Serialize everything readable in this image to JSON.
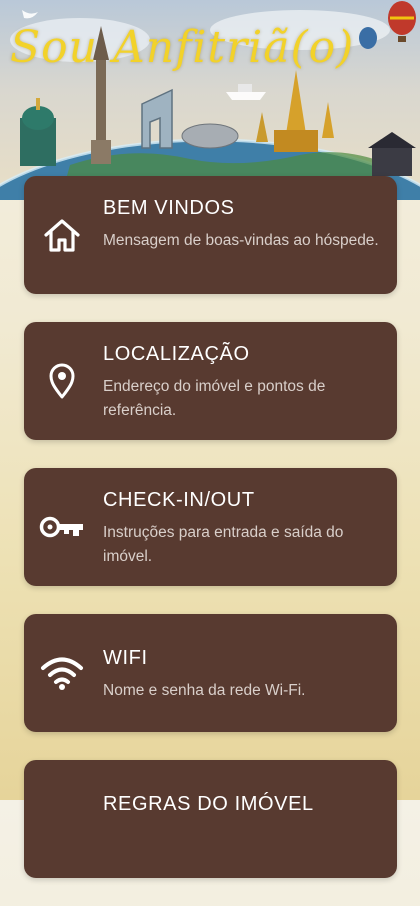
{
  "header": {
    "title": "Sou Anfitriã(o)",
    "title_color": "#f2d22a"
  },
  "menu": {
    "card_color": "#583a30",
    "items": [
      {
        "icon": "home-icon",
        "label": "BEM VINDOS",
        "description": "Mensagem de boas-vindas ao hóspede."
      },
      {
        "icon": "location-pin-icon",
        "label": "LOCALIZAÇÃO",
        "description": "Endereço do imóvel e pontos de referência."
      },
      {
        "icon": "key-icon",
        "label": "CHECK-IN/OUT",
        "description": "Instruções para entrada e saída do imóvel."
      },
      {
        "icon": "wifi-icon",
        "label": "WIFI",
        "description": "Nome e senha da rede Wi-Fi."
      },
      {
        "icon": "",
        "label": "REGRAS DO IMÓVEL",
        "description": ""
      }
    ]
  }
}
